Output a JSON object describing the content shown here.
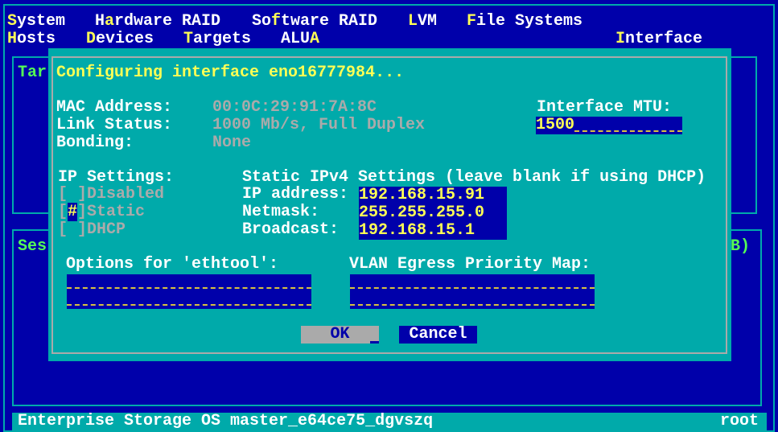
{
  "menu": {
    "row1": [
      {
        "hot": "S",
        "rest": "ystem"
      },
      {
        "pre": "H",
        "hot": "a",
        "rest": "rdware RAID"
      },
      {
        "pre": "So",
        "hot": "f",
        "rest": "tware RAID"
      },
      {
        "hot": "L",
        "rest": "VM"
      },
      {
        "hot": "F",
        "rest": "ile Systems"
      }
    ],
    "row2": [
      {
        "hot": "H",
        "rest": "osts"
      },
      {
        "hot": "D",
        "rest": "evices"
      },
      {
        "hot": "T",
        "rest": "argets"
      },
      {
        "pre": "ALU",
        "hot": "A",
        "rest": ""
      },
      {
        "hot": "I",
        "rest": "nterface"
      }
    ]
  },
  "background": {
    "panel1_title": "Tar",
    "panel2_title": "Ses",
    "panel2_right": "B)"
  },
  "dialog": {
    "title": "Configuring interface eno16777984...",
    "mac_label": "MAC Address:",
    "mac_value": "00:0C:29:91:7A:8C",
    "link_label": "Link Status:",
    "link_value": "1000 Mb/s, Full Duplex",
    "bond_label": "Bonding:",
    "bond_value": "None",
    "mtu_label": "Interface MTU:",
    "mtu_value": "1500",
    "ip_settings_label": "IP Settings:",
    "radio": [
      {
        "label": "Disabled",
        "mark": " "
      },
      {
        "label": "Static",
        "mark": "#"
      },
      {
        "label": "DHCP",
        "mark": " "
      }
    ],
    "static_header": "Static IPv4 Settings (leave blank if using DHCP)",
    "ip_label": "IP address:",
    "ip_value": "192.168.15.91",
    "netmask_label": "Netmask:",
    "netmask_value": "255.255.255.0",
    "broadcast_label": "Broadcast:",
    "broadcast_value": "192.168.15.1",
    "ethtool_label": "Options for 'ethtool':",
    "ethtool_value": "",
    "vlan_label": "VLAN Egress Priority Map:",
    "vlan_value": "",
    "ok_label": "OK",
    "cancel_label": "Cancel"
  },
  "status": {
    "left": "Enterprise Storage OS master_e64ce75_dgvszq",
    "right": "root"
  },
  "colors": {
    "background": "#0000aa",
    "dialog": "#00aaaa",
    "highlight": "#ffff55",
    "disabled": "#aaaaaa",
    "accent_green": "#55ff55"
  }
}
